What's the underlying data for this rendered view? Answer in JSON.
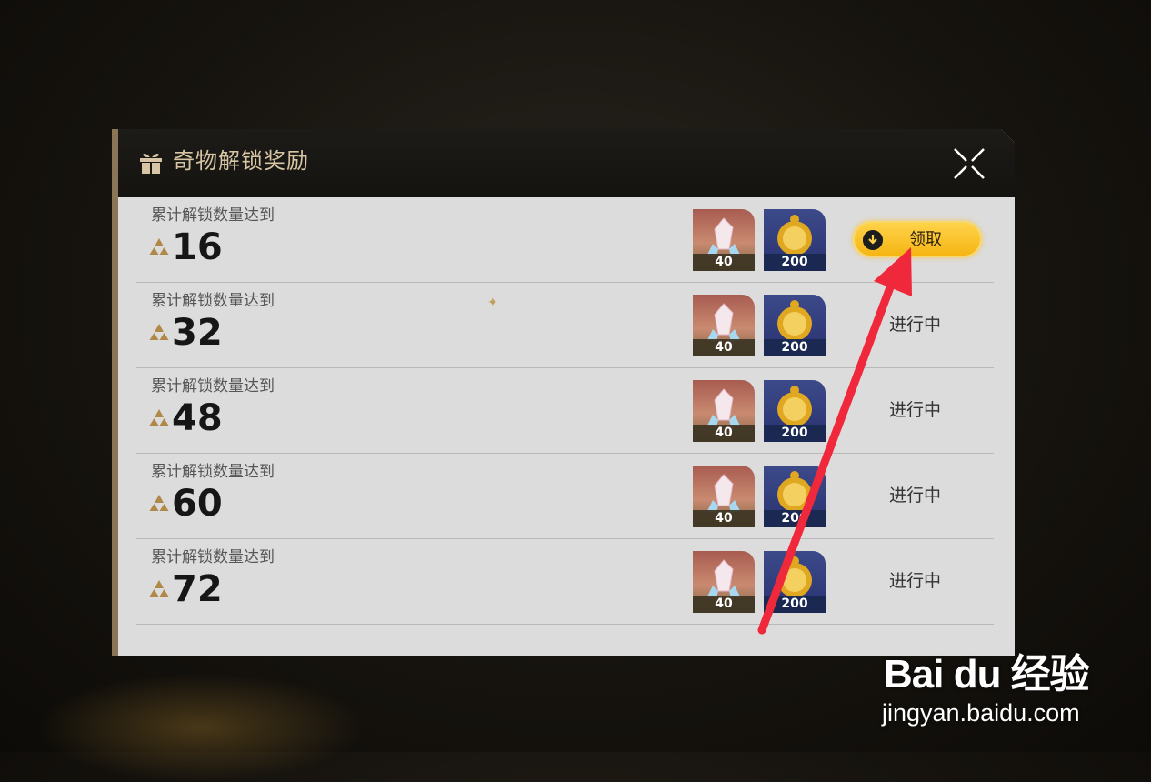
{
  "dialog": {
    "title": "奇物解锁奖励",
    "accent_color": "#d8c5a4"
  },
  "rows": [
    {
      "label": "累计解锁数量达到",
      "count": "16",
      "rewards": [
        "40",
        "200"
      ],
      "status": "领取",
      "claimable": true
    },
    {
      "label": "累计解锁数量达到",
      "count": "32",
      "rewards": [
        "40",
        "200"
      ],
      "status": "进行中",
      "claimable": false
    },
    {
      "label": "累计解锁数量达到",
      "count": "48",
      "rewards": [
        "40",
        "200"
      ],
      "status": "进行中",
      "claimable": false
    },
    {
      "label": "累计解锁数量达到",
      "count": "60",
      "rewards": [
        "40",
        "200"
      ],
      "status": "进行中",
      "claimable": false
    },
    {
      "label": "累计解锁数量达到",
      "count": "72",
      "rewards": [
        "40",
        "200"
      ],
      "status": "进行中",
      "claimable": false
    }
  ],
  "icons": {
    "header": "gift-icon",
    "close": "close-icon",
    "count": "triangle-icon",
    "reward_1": "crystal-icon",
    "reward_2": "coin-bag-icon",
    "claim": "download-arrow-icon"
  },
  "colors": {
    "claim_button": "#f5b514",
    "annotation_arrow": "#f0283c"
  },
  "watermark": {
    "logo": "Bai du 经验",
    "url": "jingyan.baidu.com"
  }
}
